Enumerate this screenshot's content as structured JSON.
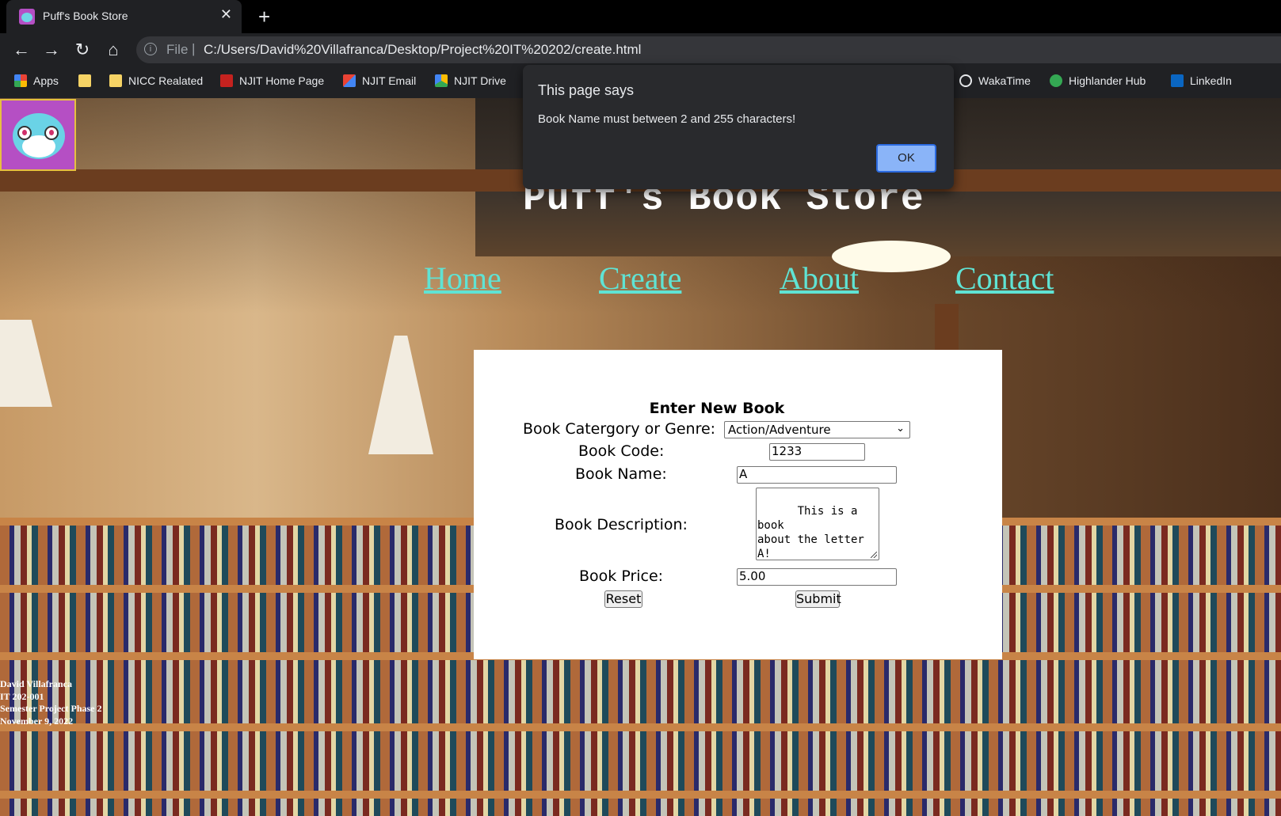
{
  "browser": {
    "tab_title": "Puff's Book Store",
    "address_scheme": "File",
    "url": "C:/Users/David%20Villafranca/Desktop/Project%20IT%20202/create.html",
    "bookmarks": [
      {
        "label": "Apps",
        "color": "#ea4335"
      },
      {
        "label": "",
        "color": "#f6d365"
      },
      {
        "label": "NICC Realated",
        "color": "#f6d365"
      },
      {
        "label": "NJIT Home Page",
        "color": "#c5221f"
      },
      {
        "label": "NJIT Email",
        "color": "#ea4335"
      },
      {
        "label": "NJIT Drive",
        "color": "#34a853"
      },
      {
        "label": "WakaTime",
        "color": "#e8eaed"
      },
      {
        "label": "Highlander Hub",
        "color": "#34a853"
      },
      {
        "label": "LinkedIn",
        "color": "#0a66c2"
      }
    ]
  },
  "site": {
    "title": "Puff's Book Store",
    "nav": [
      "Home",
      "Create",
      "About",
      "Contact"
    ],
    "link_color": "#5fe3d4"
  },
  "form": {
    "title": "Enter New Book",
    "category_label": "Book Catergory or Genre:",
    "category_value": "Action/Adventure",
    "code_label": "Book Code:",
    "code_value": "1233",
    "name_label": "Book Name:",
    "name_value": "A",
    "description_label": "Book Description:",
    "description_value": "This is a book\nabout the letter\nA!",
    "price_label": "Book Price:",
    "price_value": "5.00",
    "reset_label": "Reset",
    "submit_label": "Submit"
  },
  "credits": [
    "David Villafranca",
    "IT 202-001",
    "Semester Project Phase 2",
    "November 9, 2022"
  ],
  "dialog": {
    "title": "This page says",
    "message": "Book Name must between 2 and 255 characters!",
    "ok_label": "OK"
  }
}
